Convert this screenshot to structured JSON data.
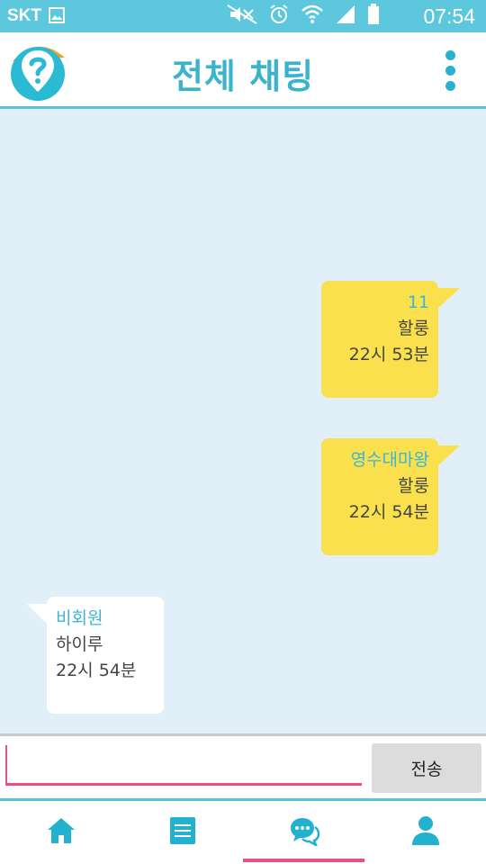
{
  "status_bar": {
    "carrier": "SKT",
    "time": "07:54",
    "icons": [
      "image-icon",
      "mute-icon",
      "alarm-icon",
      "wifi-icon",
      "signal-icon",
      "battery-icon"
    ]
  },
  "app_bar": {
    "title": "전체 채팅",
    "logo_icon": "question-pin-logo",
    "menu_icon": "more-vert-icon"
  },
  "messages": [
    {
      "sender": "11",
      "text": "할룽",
      "time": "22시 53분",
      "mine": true
    },
    {
      "sender": "영수대마왕",
      "text": "할룽",
      "time": "22시 54분",
      "mine": true
    },
    {
      "sender": "비회원",
      "text": "하이루",
      "time": "22시 54분",
      "mine": false
    }
  ],
  "composer": {
    "value": "",
    "placeholder": "",
    "send_label": "전송"
  },
  "bottom_nav": {
    "items": [
      {
        "icon": "home-icon",
        "active": false
      },
      {
        "icon": "list-icon",
        "active": false
      },
      {
        "icon": "chat-icon",
        "active": true
      },
      {
        "icon": "person-icon",
        "active": false
      }
    ]
  },
  "colors": {
    "status_bar": "#5dc7dd",
    "title": "#3ab3cd",
    "chat_bg": "#e1eff9",
    "my_bubble": "#f9e04c",
    "their_bubble": "#ffffff",
    "sender_name": "#3cb6d4",
    "accent_pink": "#e8508a",
    "nav_icon": "#22b2cf"
  }
}
